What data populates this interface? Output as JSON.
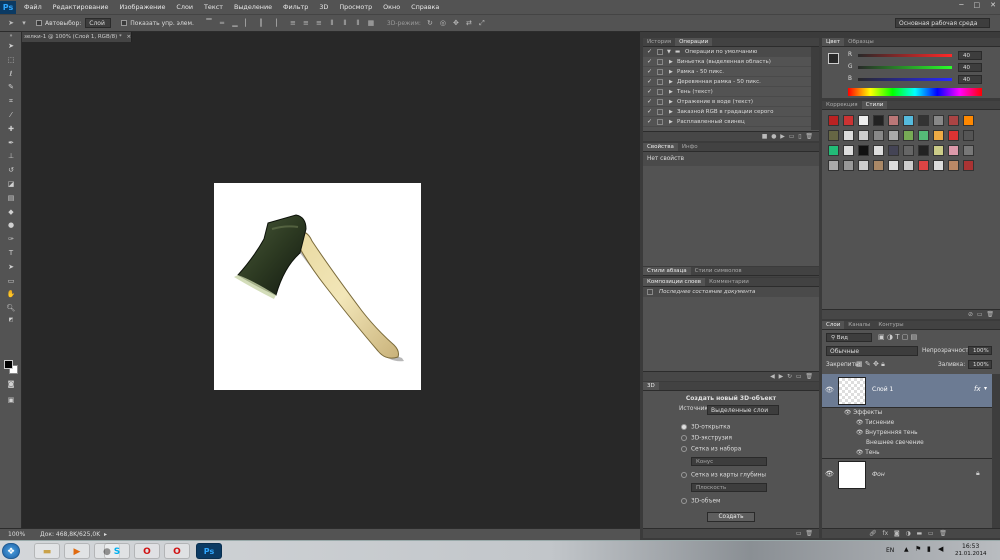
{
  "menubar": {
    "logo": "Ps",
    "items": [
      "Файл",
      "Редактирование",
      "Изображение",
      "Слои",
      "Текст",
      "Выделение",
      "Фильтр",
      "3D",
      "Просмотр",
      "Окно",
      "Справка"
    ],
    "win_min": "─",
    "win_max": "□",
    "win_close": "✕"
  },
  "options": {
    "autoselect_label": "Автовыбор:",
    "autoselect_value": "Слой",
    "show_transform_label": "Показать упр. элем.",
    "mode_3d_label": "3D-режим:",
    "workspace": "Основная рабочая среда"
  },
  "document": {
    "tab_title": "зелки-1 @ 100% (Слой 1, RGB/8) *",
    "zoom": "100%",
    "doc_info": "Док: 468,8K/625,0K"
  },
  "history_panel": {
    "tabs": [
      "История",
      "Операции"
    ],
    "rows": [
      "Операции по умолчанию",
      "Виньетка (выделенная область)",
      "Рамка - 50 пикс.",
      "Деревянная рамка - 50 пикс.",
      "Тень (текст)",
      "Отражение в воде (текст)",
      "Заказной RGB в градации серого",
      "Расплавленный свинец"
    ]
  },
  "properties_panel": {
    "tabs": [
      "Свойства",
      "Инфо"
    ],
    "body": "Нет свойств"
  },
  "styles_panel_small": {
    "tabs": [
      "Стили абзаца",
      "Стили символов"
    ]
  },
  "comps_panel": {
    "tabs": [
      "Композиции слоев",
      "Комментарии"
    ],
    "row": "Последнее состояние документа"
  },
  "panel_3d": {
    "tab": "3D",
    "title": "Создать новый 3D-объект",
    "source_label": "Источник:",
    "source_value": "Выделенные слои",
    "options": [
      "3D-открытка",
      "3D-экструзия",
      "Сетка из набора",
      "Сетка из карты глубины",
      "3D-объем"
    ],
    "preset_value": "Конус",
    "depth_value": "Плоскость",
    "create_button": "Создать"
  },
  "color_panel": {
    "tabs": [
      "Цвет",
      "Образцы"
    ],
    "channels": [
      {
        "name": "R",
        "value": "40"
      },
      {
        "name": "G",
        "value": "40"
      },
      {
        "name": "B",
        "value": "40"
      }
    ]
  },
  "styles_panel": {
    "tabs": [
      "Коррекция",
      "Стили"
    ],
    "swatch_colors": [
      "#b22",
      "#c33",
      "#eee",
      "#222",
      "#b77",
      "#5bd",
      "#333",
      "#888",
      "#a44",
      "#f80",
      "#664",
      "#ddd",
      "#ccc",
      "#888",
      "#aaa",
      "#7a5",
      "#5b7",
      "#ea4",
      "#d33",
      "#555",
      "#2b7",
      "#ddd",
      "#111",
      "#ddd",
      "#445",
      "#666",
      "#222",
      "#cc8",
      "#d9a",
      "#777",
      "#aaa",
      "#999",
      "#ccc",
      "#a86",
      "#ddd",
      "#ccc",
      "#d44",
      "#ddd",
      "#b86",
      "#a33"
    ]
  },
  "layers_panel": {
    "tabs": [
      "Слои",
      "Каналы",
      "Контуры"
    ],
    "kind_filter": "Вид",
    "blend_mode": "Обычные",
    "opacity_label": "Непрозрачность:",
    "opacity_value": "100%",
    "lock_label": "Закрепить:",
    "fill_label": "Заливка:",
    "fill_value": "100%",
    "layer1_name": "Слой 1",
    "fx_badge": "fx",
    "effects_label": "Эффекты",
    "effects": [
      "Тиснение",
      "Внутренняя тень",
      "Внешнее свечение",
      "Тень"
    ],
    "bg_name": "Фон"
  },
  "taskbar": {
    "lang": "EN",
    "time": "16:53",
    "date": "21.01.2014",
    "ps_label": "Ps"
  }
}
